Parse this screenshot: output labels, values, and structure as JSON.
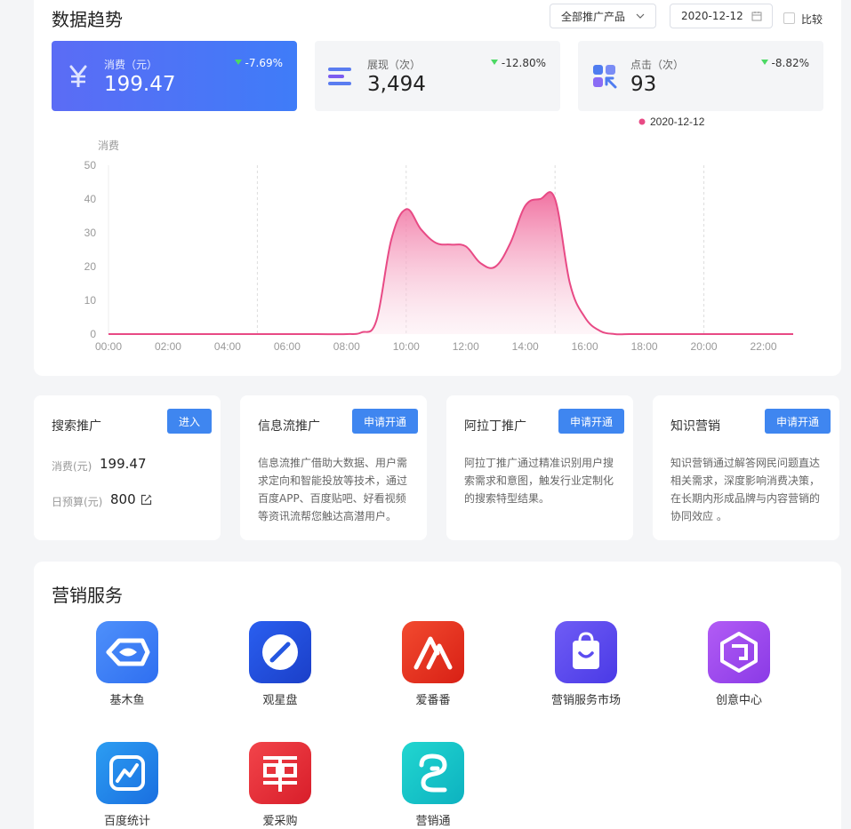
{
  "trend": {
    "title": "数据趋势",
    "product_select": "全部推广产品",
    "date": "2020-12-12",
    "compare_label": "比较"
  },
  "stats": [
    {
      "icon": "yuan-icon",
      "label": "消费（元）",
      "value": "199.47",
      "delta": "-7.69%",
      "active": true
    },
    {
      "icon": "bars-icon",
      "label": "展现（次）",
      "value": "3,494",
      "delta": "-12.80%",
      "active": false
    },
    {
      "icon": "apps-icon",
      "label": "点击（次）",
      "value": "93",
      "delta": "-8.82%",
      "active": false
    }
  ],
  "chart_data": {
    "type": "area",
    "ylabel": "消费",
    "legend": [
      "2020-12-12"
    ],
    "legend_position": "top-right",
    "ylim": [
      0,
      50
    ],
    "yticks": [
      0,
      10,
      20,
      30,
      40,
      50
    ],
    "xticks": [
      "00:00",
      "02:00",
      "04:00",
      "06:00",
      "08:00",
      "10:00",
      "12:00",
      "14:00",
      "16:00",
      "18:00",
      "20:00",
      "22:00"
    ],
    "x": [
      0,
      1,
      2,
      3,
      4,
      5,
      6,
      7,
      8,
      8.5,
      9,
      9.5,
      10,
      10.5,
      11,
      11.5,
      12,
      12.5,
      13,
      13.5,
      14,
      14.5,
      15,
      15.5,
      16,
      16.5,
      17,
      17.5,
      18,
      19,
      20,
      21,
      22,
      23
    ],
    "series": [
      {
        "name": "2020-12-12",
        "color": "#e84a85",
        "values": [
          0,
          0,
          0,
          0,
          0,
          0,
          0,
          0,
          0,
          0.5,
          4,
          28,
          37,
          31,
          27,
          26.5,
          26,
          21,
          20,
          27,
          38,
          40,
          40,
          15,
          5,
          1,
          0,
          0,
          0,
          0,
          0,
          0,
          0,
          0
        ]
      }
    ],
    "grid": "vertical dashed"
  },
  "cards": [
    {
      "title": "搜索推广",
      "button": "进入",
      "spend_label": "消费(元)",
      "spend_value": "199.47",
      "budget_label": "日预算(元)",
      "budget_value": "800"
    },
    {
      "title": "信息流推广",
      "button": "申请开通",
      "desc": "信息流推广借助大数据、用户需求定向和智能投放等技术，通过百度APP、百度贴吧、好看视频等资讯流帮您触达高潜用户。"
    },
    {
      "title": "阿拉丁推广",
      "button": "申请开通",
      "desc": "阿拉丁推广通过精准识别用户搜索需求和意图，触发行业定制化的搜索特型结果。"
    },
    {
      "title": "知识营销",
      "button": "申请开通",
      "desc": "知识营销通过解答网民问题直达相关需求，深度影响消费决策，在长期内形成品牌与内容营销的协同效应 。"
    }
  ],
  "services": {
    "title": "营销服务",
    "items": [
      {
        "name": "基木鱼",
        "icon": "fish-icon",
        "color": "#3d7ef5"
      },
      {
        "name": "观星盘",
        "icon": "compass-icon",
        "color": "#2457e0"
      },
      {
        "name": "爱番番",
        "icon": "aifanfan-icon",
        "color": "#e8331f"
      },
      {
        "name": "营销服务市场",
        "icon": "shopping-bag-icon",
        "color": "#5b4cf0"
      },
      {
        "name": "创意中心",
        "icon": "cube-icon",
        "color": "#9b4cf0"
      },
      {
        "name": "百度统计",
        "icon": "stats-icon",
        "color": "#2a8ae8"
      },
      {
        "name": "爱采购",
        "icon": "aicaigou-icon",
        "color": "#e8333a"
      },
      {
        "name": "营销通",
        "icon": "yingxiaotong-icon",
        "color": "#16c4c4"
      }
    ]
  }
}
